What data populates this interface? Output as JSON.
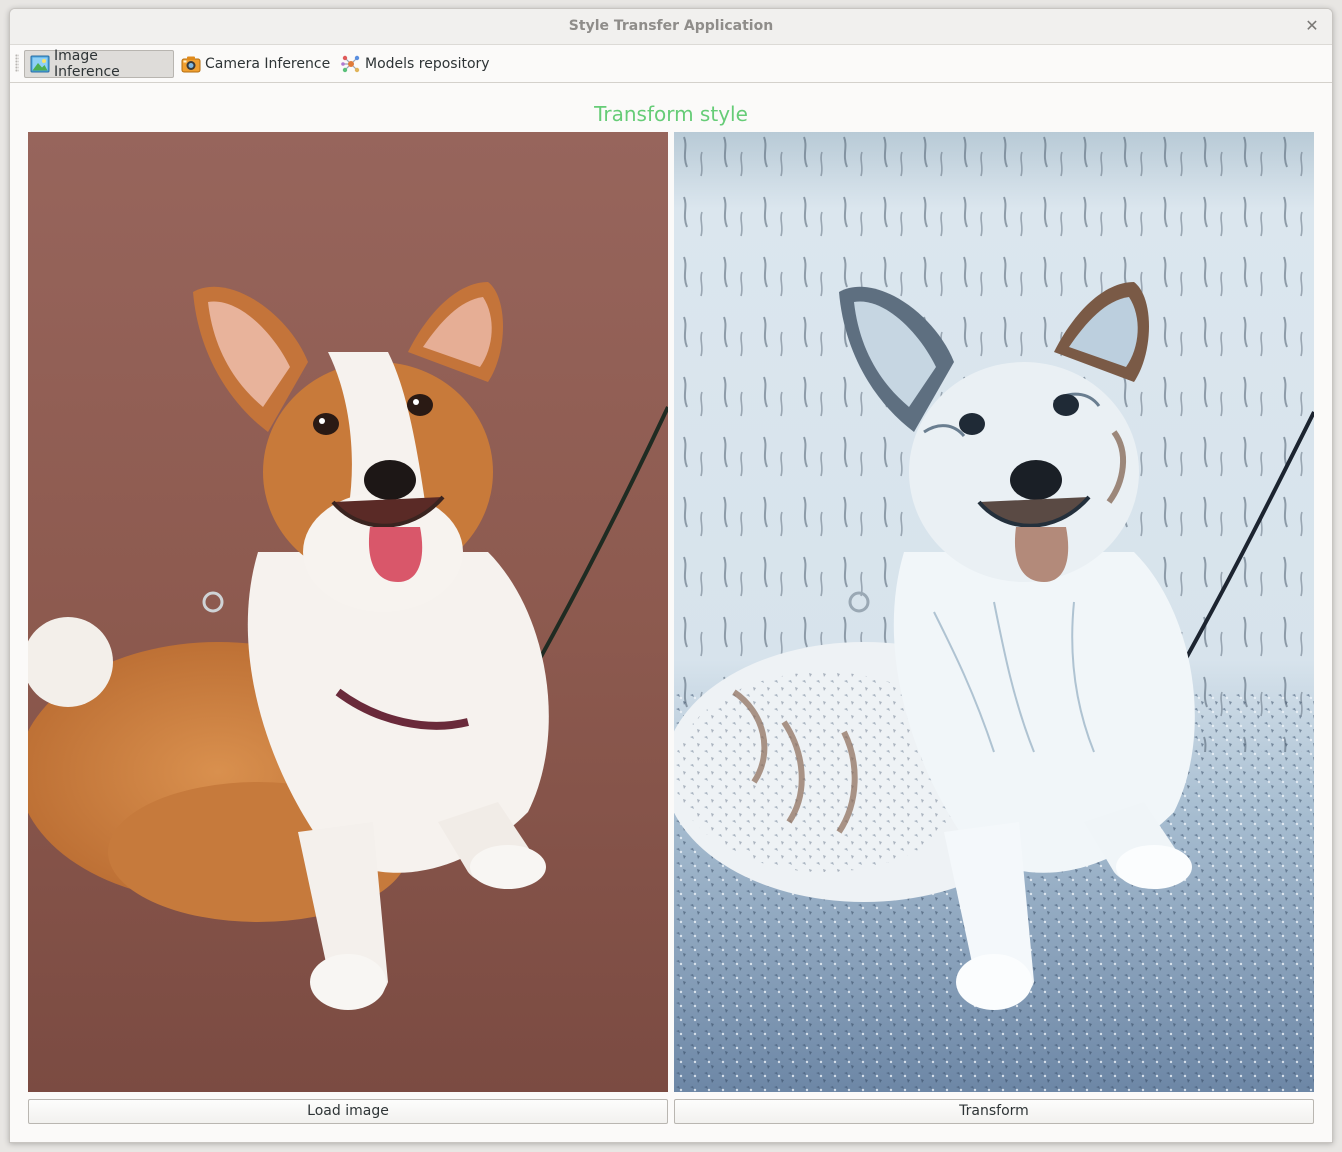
{
  "window": {
    "title": "Style Transfer Application"
  },
  "toolbar": {
    "items": [
      {
        "label": "Image Inference",
        "icon": "image-icon",
        "active": true
      },
      {
        "label": "Camera Inference",
        "icon": "camera-icon",
        "active": false
      },
      {
        "label": "Models repository",
        "icon": "models-icon",
        "active": false
      }
    ]
  },
  "main": {
    "heading": "Transform style",
    "heading_color": "#66cc77",
    "source_image": {
      "subject": "photo of a corgi dog sitting on reddish pavement with a leash"
    },
    "styled_image": {
      "subject": "style-transferred corgi image in blue-white painterly style"
    },
    "load_button_label": "Load image",
    "transform_button_label": "Transform"
  }
}
